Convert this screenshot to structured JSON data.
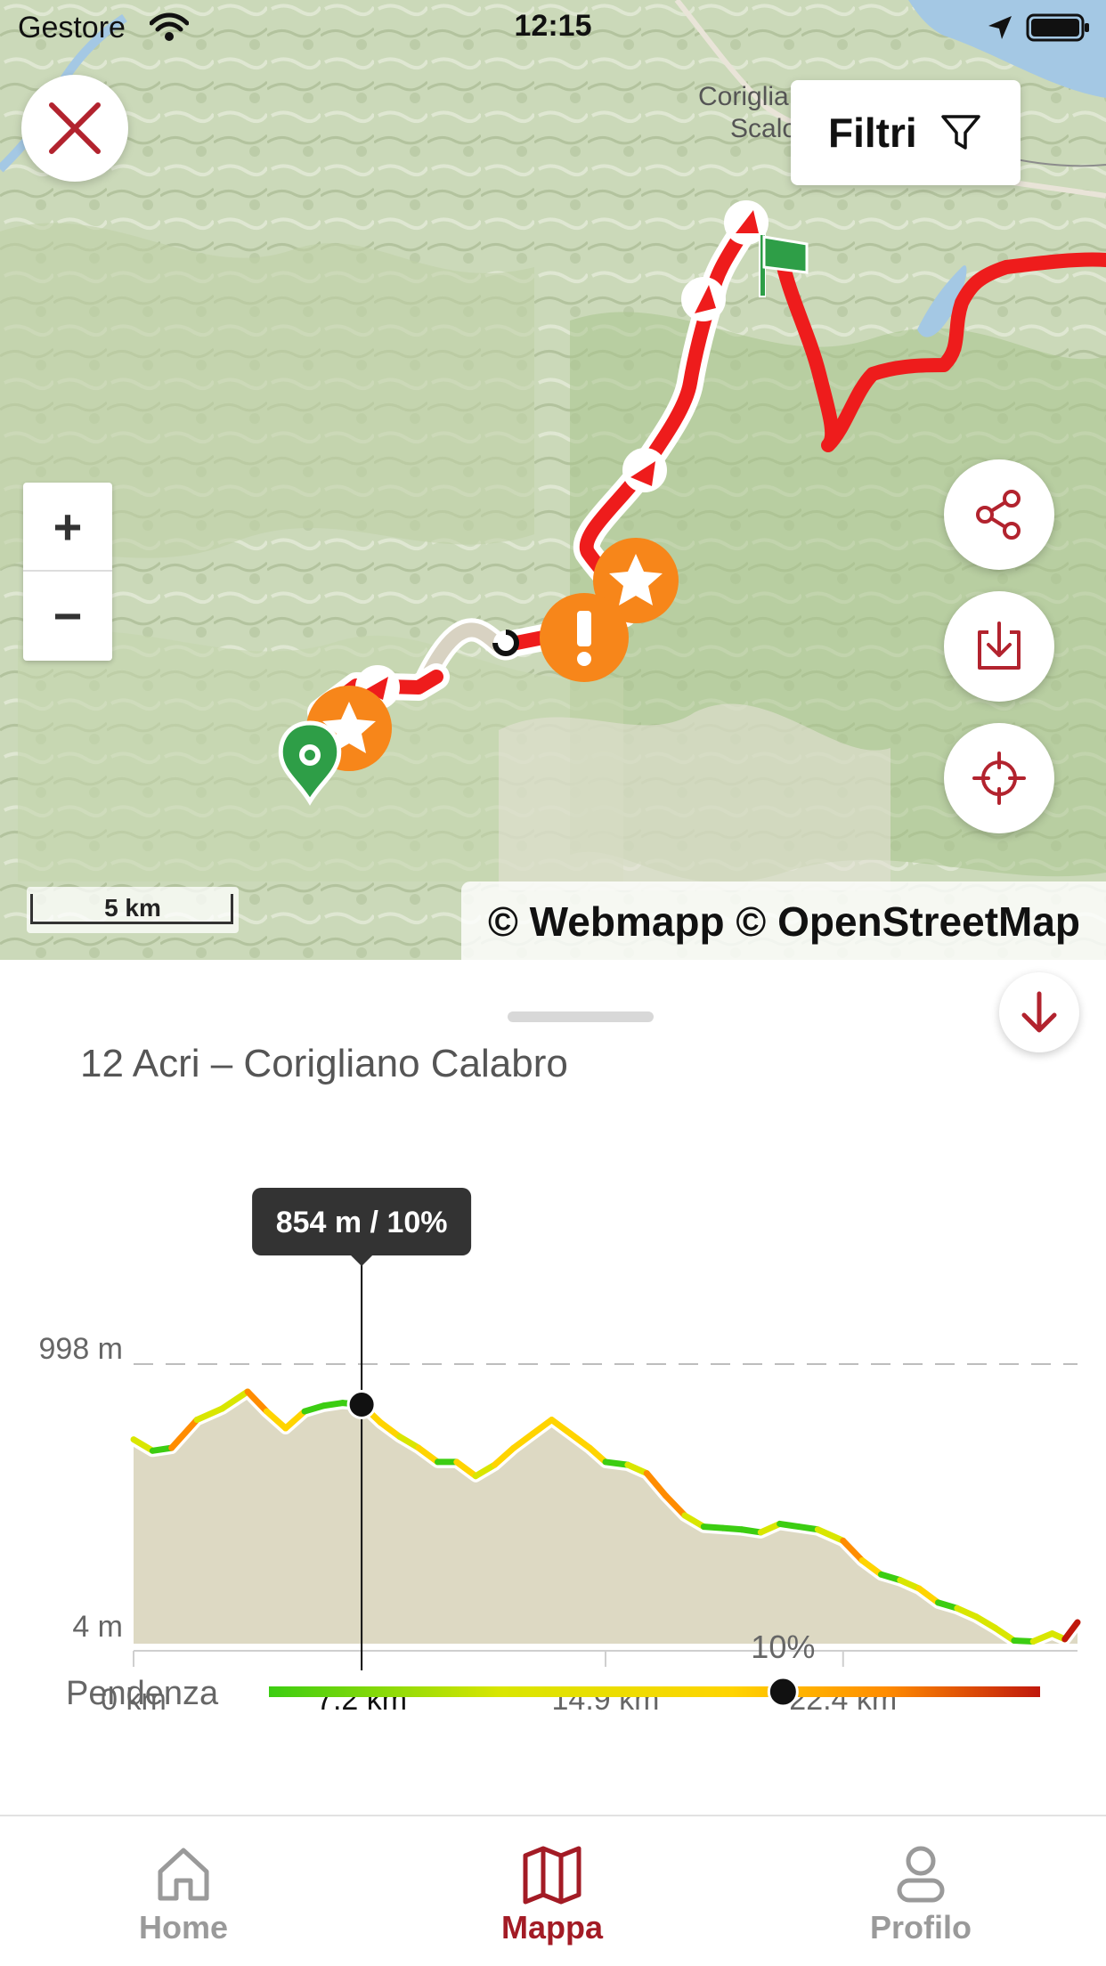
{
  "status_bar": {
    "carrier": "Gestore",
    "time": "12:15"
  },
  "map": {
    "place_label_line1": "Coriglia",
    "place_label_line2": "Scalo",
    "filter_button": {
      "label": "Filtri",
      "icon": "funnel-icon"
    },
    "close_button": {
      "icon": "close-x-icon"
    },
    "zoom_in_label": "+",
    "zoom_out_label": "−",
    "scale_label": "5 km",
    "attribution": "© Webmapp © OpenStreetMap",
    "actions": [
      "share-icon",
      "download-icon",
      "locate-crosshair-icon"
    ],
    "markers": [
      "start-pin-icon",
      "poi-star-icon",
      "poi-star-icon",
      "warning-icon",
      "finish-flag-icon"
    ]
  },
  "panel": {
    "title": "12 Acri – Corigliano Calabro",
    "collapse_icon": "arrow-down-icon"
  },
  "chart_data": {
    "type": "area",
    "title": "",
    "xlabel": "",
    "ylabel": "",
    "y_tick_labels": [
      "998 m",
      "4 m"
    ],
    "x_tick_labels": [
      "0 km",
      "7.2 km",
      "14.9 km",
      "22.4 km"
    ],
    "ylim": [
      4,
      998
    ],
    "xlim": [
      0,
      29.8
    ],
    "x_unit": "km",
    "y_unit": "m",
    "series": [
      {
        "x": [
          0,
          0.6,
          1.2,
          2.0,
          2.8,
          3.6,
          4.2,
          4.8,
          5.4,
          6.0,
          6.6,
          7.2,
          7.8,
          8.4,
          9.0,
          9.6,
          10.2,
          10.8,
          11.4,
          12.0,
          12.6,
          13.2,
          13.8,
          14.4,
          14.9,
          15.6,
          16.2,
          16.8,
          17.4,
          18.0,
          18.6,
          19.2,
          19.8,
          20.4,
          21.0,
          21.6,
          22.4,
          23.0,
          23.6,
          24.2,
          24.8,
          25.4,
          26.0,
          26.6,
          27.2,
          27.8,
          28.4,
          29.0,
          29.4,
          29.8
        ],
        "values": [
          730,
          690,
          700,
          800,
          840,
          900,
          830,
          770,
          830,
          850,
          860,
          854,
          790,
          740,
          700,
          650,
          650,
          600,
          640,
          700,
          750,
          800,
          750,
          700,
          650,
          640,
          610,
          530,
          460,
          420,
          415,
          410,
          400,
          430,
          420,
          410,
          370,
          300,
          250,
          230,
          200,
          150,
          130,
          100,
          60,
          15,
          12,
          40,
          20,
          80
        ]
      }
    ],
    "selected_point": {
      "x": 7.2,
      "y": 854,
      "grade_percent": 10,
      "tooltip": "854 m / 10%"
    },
    "grid": "dashed max line"
  },
  "slope_legend": {
    "label": "Pendenza",
    "current_value_label": "10%",
    "current_value": 10,
    "colors": [
      "#3ccd12",
      "#d9e600",
      "#ffd400",
      "#ff8c00",
      "#c0180c"
    ]
  },
  "tabbar": {
    "active_color": "#a31b25",
    "inactive_color": "#9a9a9a",
    "tabs": [
      {
        "label": "Home",
        "icon": "home-icon"
      },
      {
        "label": "Mappa",
        "icon": "map-icon"
      },
      {
        "label": "Profilo",
        "icon": "profile-icon"
      }
    ]
  }
}
